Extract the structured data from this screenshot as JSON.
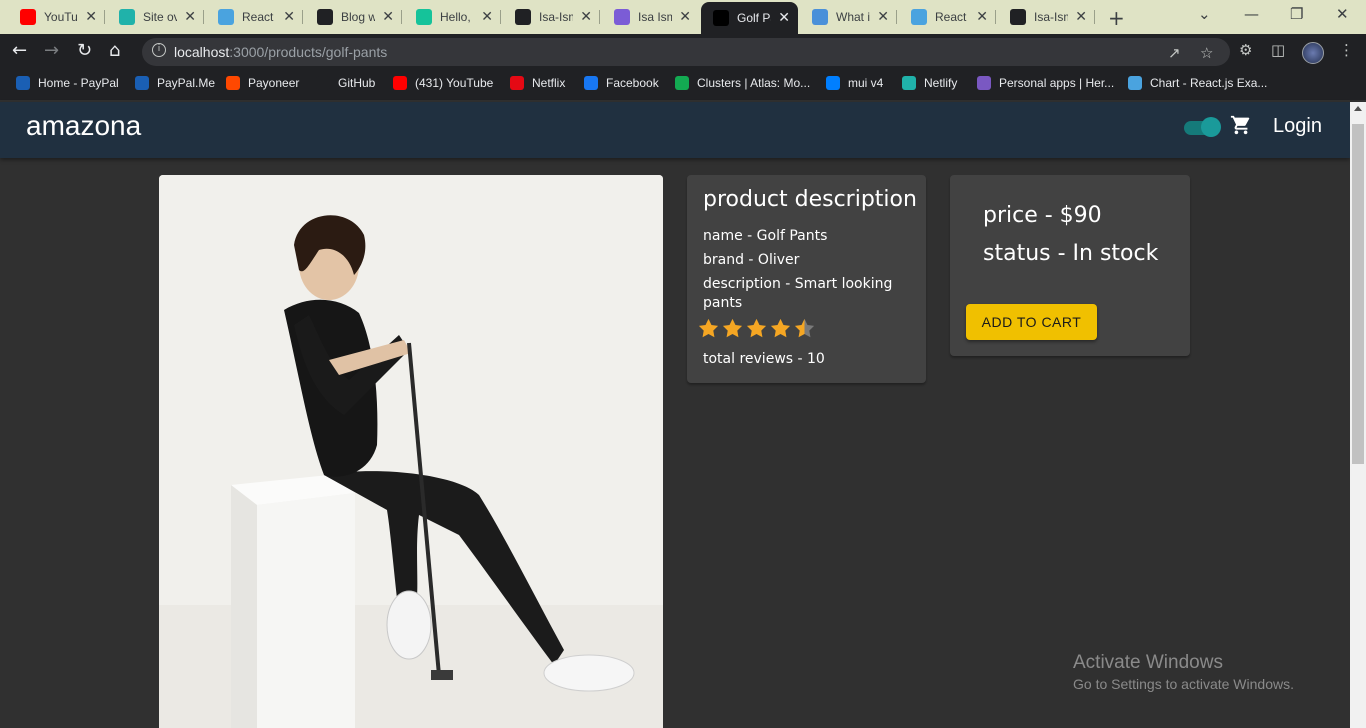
{
  "browser": {
    "tabs": [
      {
        "title": "YouTube",
        "icon": "youtube-icon",
        "color": "#ff0000"
      },
      {
        "title": "Site overview",
        "icon": "netlify-icon",
        "color": "#20b2aa"
      },
      {
        "title": "React App",
        "icon": "react-icon",
        "color": "#4aa3df"
      },
      {
        "title": "Blog website",
        "icon": "s-icon",
        "color": "#202124"
      },
      {
        "title": "Hello, ",
        "icon": "grammarly-icon",
        "color": "#15c39a"
      },
      {
        "title": "Isa-Ismail",
        "icon": "github-icon",
        "color": "#202124"
      },
      {
        "title": "Isa Ismail",
        "icon": "profile-icon",
        "color": "#7b5cd6"
      },
      {
        "title": "Golf Pants",
        "icon": "nextjs-icon",
        "color": "#000000"
      },
      {
        "title": "What is",
        "icon": "book-icon",
        "color": "#4a90d9"
      },
      {
        "title": "React App",
        "icon": "react-icon",
        "color": "#4aa3df"
      },
      {
        "title": "Isa-Ismail",
        "icon": "github-icon",
        "color": "#202124"
      }
    ],
    "active_tab_index": 7,
    "url_host": "localhost",
    "url_path": ":3000/products/golf-pants",
    "bookmarks": [
      {
        "label": "Home - PayPal",
        "icon": "paypal-icon",
        "color": "#1a5fb4"
      },
      {
        "label": "PayPal.Me",
        "icon": "paypal-icon",
        "color": "#1a5fb4"
      },
      {
        "label": "Payoneer",
        "icon": "payoneer-icon",
        "color": "#ff4800"
      },
      {
        "label": "GitHub",
        "icon": "github-icon",
        "color": "#202124"
      },
      {
        "label": "(431) YouTube",
        "icon": "youtube-icon",
        "color": "#ff0000"
      },
      {
        "label": "Netflix",
        "icon": "netflix-icon",
        "color": "#e50914"
      },
      {
        "label": "Facebook",
        "icon": "facebook-icon",
        "color": "#1877f2"
      },
      {
        "label": "Clusters | Atlas: Mo...",
        "icon": "mongodb-icon",
        "color": "#13aa52"
      },
      {
        "label": "mui v4",
        "icon": "mui-icon",
        "color": "#007fff"
      },
      {
        "label": "Netlify",
        "icon": "netlify-icon",
        "color": "#20b2aa"
      },
      {
        "label": "Personal apps | Her...",
        "icon": "heroku-icon",
        "color": "#7a58c2"
      },
      {
        "label": "Chart - React.js Exa...",
        "icon": "react-icon",
        "color": "#4aa3df"
      }
    ]
  },
  "app": {
    "brand": "amazona",
    "login_label": "Login",
    "dark_mode_on": true,
    "accent_color": "#f0c000",
    "product": {
      "description_title": "product description",
      "name_line": "name - Golf Pants",
      "brand_line": "brand - Oliver",
      "description_line": "description - Smart looking pants",
      "rating": 4.5,
      "reviews_line": "total reviews - 10",
      "price_line": "price - $90",
      "status_line": "status - In stock",
      "add_to_cart_label": "ADD TO CART"
    }
  },
  "os_overlay": {
    "line1": "Activate Windows",
    "line2": "Go to Settings to activate Windows."
  }
}
